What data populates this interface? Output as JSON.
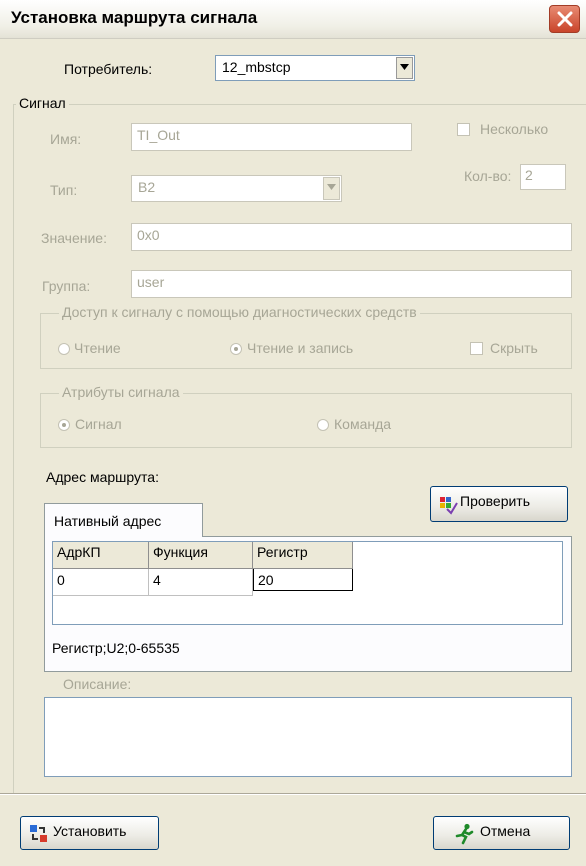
{
  "window": {
    "title": "Установка маршрута сигнала"
  },
  "consumer": {
    "label": "Потребитель:",
    "value": "12_mbstcp"
  },
  "signal": {
    "group_label": "Сигнал",
    "name_label": "Имя:",
    "name_value": "TI_Out",
    "several_label": "Несколько",
    "count_label": "Кол-во:",
    "count_value": "2",
    "type_label": "Тип:",
    "type_value": "B2",
    "value_label": "Значение:",
    "value_value": "0x0",
    "group_field_label": "Группа:",
    "group_value": "user",
    "access": {
      "legend": "Доступ к сигналу с помощью диагностических средств",
      "read": "Чтение",
      "read_write": "Чтение и запись",
      "hide": "Скрыть"
    },
    "attributes": {
      "legend": "Атрибуты сигнала",
      "signal": "Сигнал",
      "command": "Команда"
    }
  },
  "route": {
    "label": "Адрес маршрута:",
    "check_button": "Проверить",
    "tab_native": "Нативный адрес",
    "columns": [
      "АдрКП",
      "Функция",
      "Регистр"
    ],
    "row": [
      "0",
      "4",
      "20"
    ],
    "hint": "Регистр;U2;0-65535"
  },
  "description": {
    "label": "Описание:",
    "value": ""
  },
  "footer": {
    "install_button": "Установить",
    "cancel_button": "Отмена"
  }
}
